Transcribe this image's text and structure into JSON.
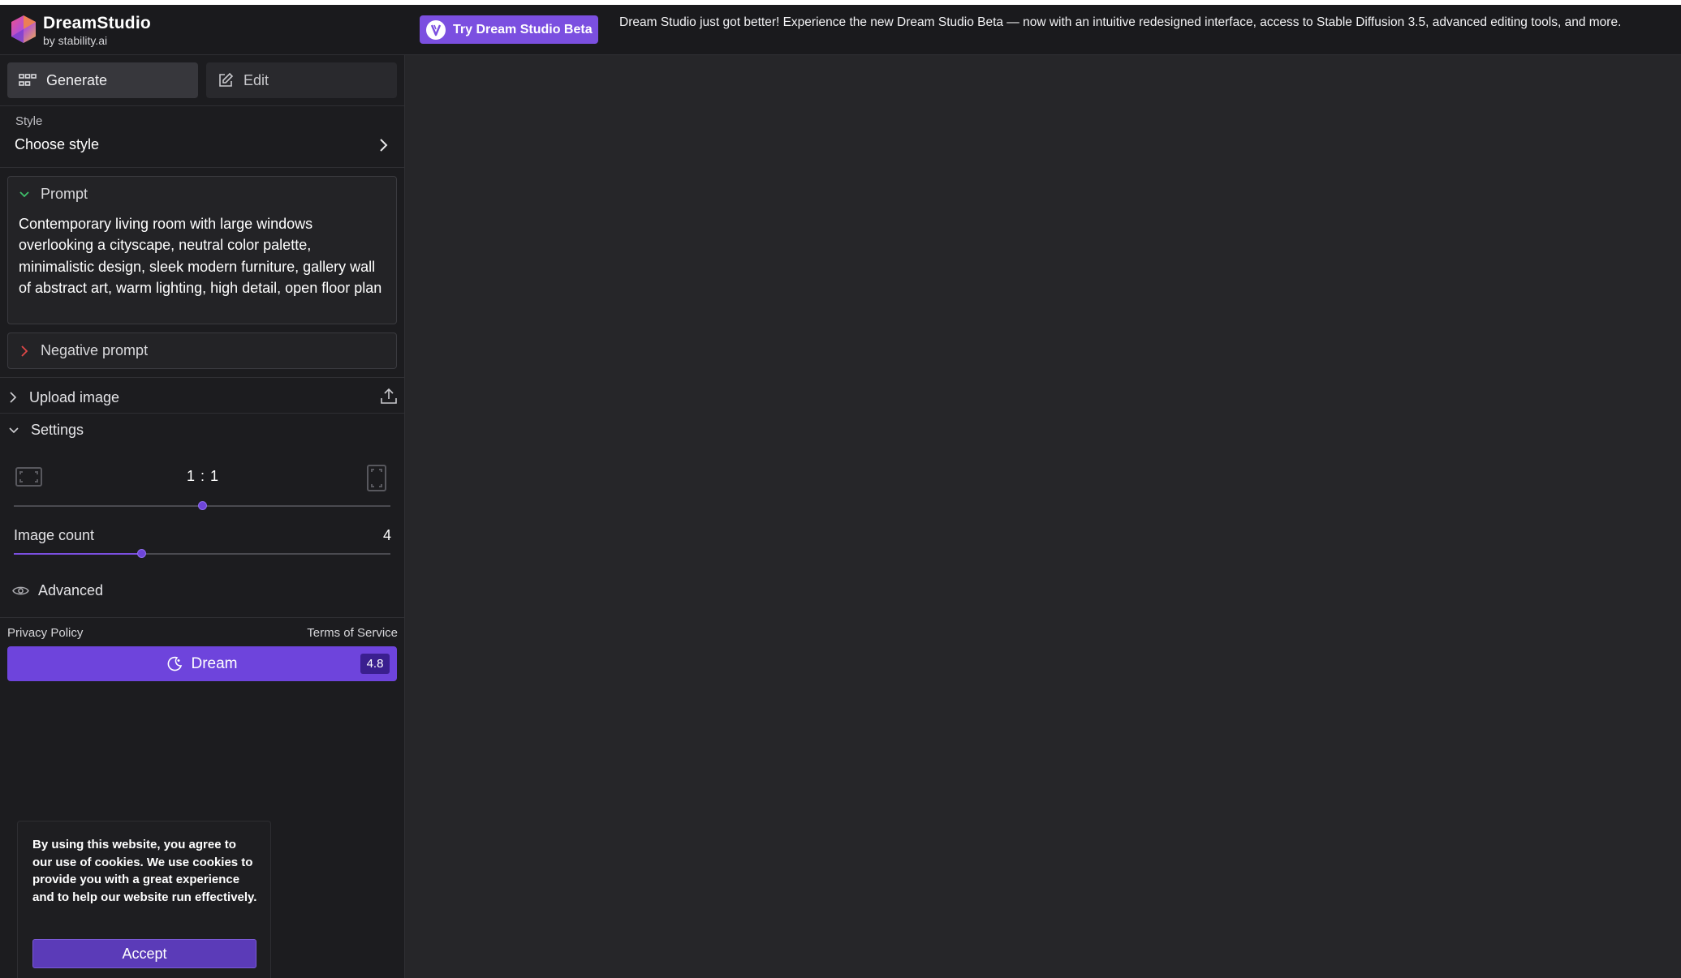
{
  "header": {
    "brand_name": "DreamStudio",
    "brand_by": "by stability.ai",
    "beta_button_label": "Try Dream Studio Beta",
    "announcement": "Dream Studio just got better! Experience the new Dream Studio Beta — now with an intuitive redesigned interface, access to Stable Diffusion 3.5, advanced editing tools, and more."
  },
  "tabs": {
    "generate": "Generate",
    "edit": "Edit"
  },
  "style": {
    "label": "Style",
    "value": "Choose style"
  },
  "prompt": {
    "label": "Prompt",
    "text": "Contemporary living room with large windows overlooking a cityscape, neutral color palette, minimalistic design, sleek modern furniture, gallery wall of abstract art, warm lighting, high detail, open floor plan"
  },
  "negative_prompt": {
    "label": "Negative prompt"
  },
  "upload": {
    "label": "Upload image"
  },
  "settings": {
    "label": "Settings",
    "aspect_ratio": "1 : 1",
    "aspect_ratio_slider_fraction": 0.5,
    "image_count_label": "Image count",
    "image_count": "4",
    "image_count_slider_fraction": 0.34,
    "advanced_label": "Advanced"
  },
  "footer_links": {
    "privacy": "Privacy Policy",
    "terms": "Terms of Service"
  },
  "dream_button": {
    "label": "Dream",
    "cost": "4.8"
  },
  "cookie": {
    "text": "By using this website, you agree to our use of cookies. We use cookies to provide you with a great experience and to help our website run effectively.",
    "accept_label": "Accept"
  },
  "colors": {
    "accent": "#6e44dc",
    "background": "#262629",
    "sidebar": "#1c1c1f"
  }
}
